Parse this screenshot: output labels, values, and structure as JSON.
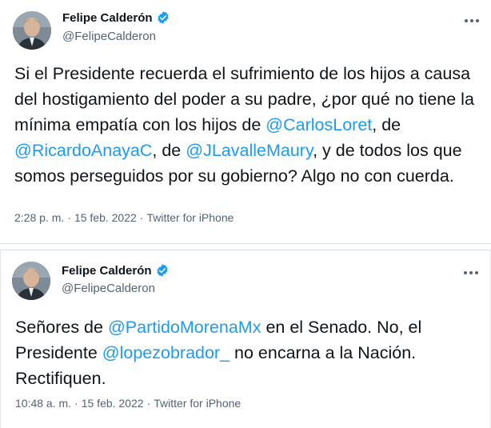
{
  "tweets": [
    {
      "display_name": "Felipe Calderón",
      "handle": "@FelipeCalderon",
      "text": [
        {
          "t": "Si el Presidente recuerda el sufrimiento de los hijos a causa del hostigamiento del poder a su padre, ¿por qué no tiene la mínima empatía con los hijos de ",
          "m": false
        },
        {
          "t": "@CarlosLoret",
          "m": true
        },
        {
          "t": ", de ",
          "m": false
        },
        {
          "t": "@RicardoAnayaC",
          "m": true
        },
        {
          "t": ", de ",
          "m": false
        },
        {
          "t": "@JLavalleMaury",
          "m": true
        },
        {
          "t": ", y de todos los que somos perseguidos por su gobierno? Algo no con cuerda.",
          "m": false
        }
      ],
      "time": "2:28 p. m.",
      "date": "15 feb. 2022",
      "source": "Twitter for iPhone"
    },
    {
      "display_name": "Felipe Calderón",
      "handle": "@FelipeCalderon",
      "text": [
        {
          "t": "Señores de ",
          "m": false
        },
        {
          "t": "@PartidoMorenaMx",
          "m": true
        },
        {
          "t": " en el Senado. No, el Presidente ",
          "m": false
        },
        {
          "t": "@lopezobrador_",
          "m": true
        },
        {
          "t": " no encarna a la Nación. Rectifiquen.",
          "m": false
        }
      ],
      "time": "10:48 a. m.",
      "date": "15 feb. 2022",
      "source": "Twitter for iPhone"
    }
  ],
  "meta_separator": "·",
  "colors": {
    "accent": "#1d9bf0",
    "text": "#0f1419",
    "secondary": "#536471"
  },
  "icons": {
    "verified": "verified-badge-icon",
    "more": "more-dots-icon"
  }
}
